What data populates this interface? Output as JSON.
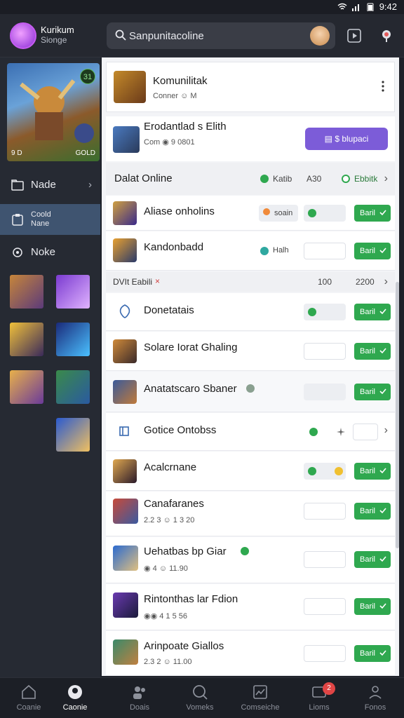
{
  "status": {
    "time": "9:42"
  },
  "header": {
    "brand_title": "Kurikum",
    "brand_sub": "Sionge",
    "search_text": "Sanpunitacoline",
    "colors": {
      "background": "#252830",
      "accent": "#8a2ad6"
    }
  },
  "sidebar": {
    "feature": {
      "badge": "31",
      "left_label": "9 D",
      "right_label": "GOLD"
    },
    "items": [
      {
        "label": "Nade",
        "icon": "folder-icon"
      },
      {
        "label": "Coold\nNane",
        "icon": "clipboard-icon"
      },
      {
        "label": "Noke",
        "icon": "gear-icon"
      }
    ]
  },
  "main": {
    "community": {
      "title": "Komunilitak",
      "meta": "Conner ☺ M"
    },
    "promo": {
      "title": "Erodantlad s Elith",
      "meta": "Com ◉ 9 0801",
      "button": "▤ $ blupaci"
    },
    "online_section": {
      "title": "Dalat Online",
      "stat1": "Katib",
      "stat2": "A30",
      "stat3": "Ebbitk"
    },
    "top_rows": [
      {
        "title": "Aliase onholins",
        "chip": "soain",
        "install": "Baril"
      },
      {
        "title": "Kandonbadd",
        "chip": "Halh",
        "install": "Baril"
      }
    ],
    "subsection": {
      "title": "DVIt Eabili",
      "stat1": "100",
      "stat2": "2200"
    },
    "rows": [
      {
        "title": "Donetatais",
        "meta": "",
        "install": "Baril"
      },
      {
        "title": "Solare Iorat Ghaling",
        "meta": "",
        "install": "Baril"
      },
      {
        "title": "Anatatscaro Sbaner",
        "meta": "",
        "install": "Baril"
      },
      {
        "title": "Gotice Ontobss",
        "meta": "",
        "install": ""
      },
      {
        "title": "Acalcrnane",
        "meta": "",
        "install": "Baril"
      },
      {
        "title": "Canafaranes",
        "meta": "2.2 3 ☺ 1 3 20",
        "install": "Baril"
      },
      {
        "title": "Uehatbas bp Giar",
        "meta": "◉ 4 ☺ 11.90",
        "install": "Baril"
      },
      {
        "title": "Rintonthas lar Fdion",
        "meta": "◉◉ 4 1 5 56",
        "install": "Baril"
      },
      {
        "title": "Arinpoate Giallos",
        "meta": "2.3 2 ☺ 11.00",
        "install": "Baril"
      }
    ]
  },
  "bottomnav": {
    "items": [
      {
        "label": "Coanie",
        "icon": "home-icon"
      },
      {
        "label": "Caonie",
        "icon": "gamepad-icon"
      },
      {
        "label": "Doais",
        "icon": "people-icon"
      },
      {
        "label": "Vomeks",
        "icon": "search-icon"
      },
      {
        "label": "Comseiche",
        "icon": "chart-icon"
      },
      {
        "label": "Lioms",
        "icon": "inbox-icon",
        "badge": "2"
      },
      {
        "label": "Fonos",
        "icon": "profile-icon"
      }
    ]
  }
}
